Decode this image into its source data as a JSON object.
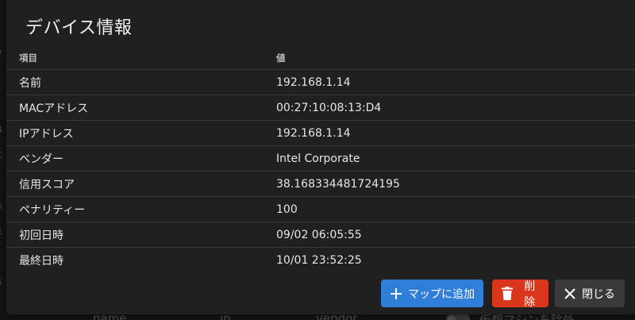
{
  "background": {
    "columns": [
      "name",
      "ip",
      "vendor"
    ],
    "exclude_vm_label": "仮想マシンを除外",
    "edge_chars": [
      ":",
      "7",
      ":",
      ":",
      "4",
      "C",
      ":",
      "6",
      "E",
      ":",
      "5"
    ]
  },
  "dialog": {
    "title": "デバイス情報",
    "headers": {
      "item": "項目",
      "value": "値"
    },
    "rows": [
      {
        "label": "名前",
        "value": "192.168.1.14"
      },
      {
        "label": "MACアドレス",
        "value": "00:27:10:08:13:D4"
      },
      {
        "label": "IPアドレス",
        "value": "192.168.1.14"
      },
      {
        "label": "ベンダー",
        "value": "Intel Corporate"
      },
      {
        "label": "信用スコア",
        "value": "38.168334481724195"
      },
      {
        "label": "ペナリティー",
        "value": "100"
      },
      {
        "label": "初回日時",
        "value": "09/02 06:05:55"
      },
      {
        "label": "最終日時",
        "value": "10/01 23:52:25"
      }
    ],
    "buttons": {
      "add_to_map": "マップに追加",
      "delete": "削除",
      "close": "閉じる"
    }
  },
  "colors": {
    "primary": "#2f7fd8",
    "danger": "#d9361b",
    "neutral": "#3a3a3a",
    "dialog_bg": "#202020"
  },
  "icons": {
    "add": "plus-icon",
    "delete": "trash-icon",
    "close": "close-icon"
  }
}
